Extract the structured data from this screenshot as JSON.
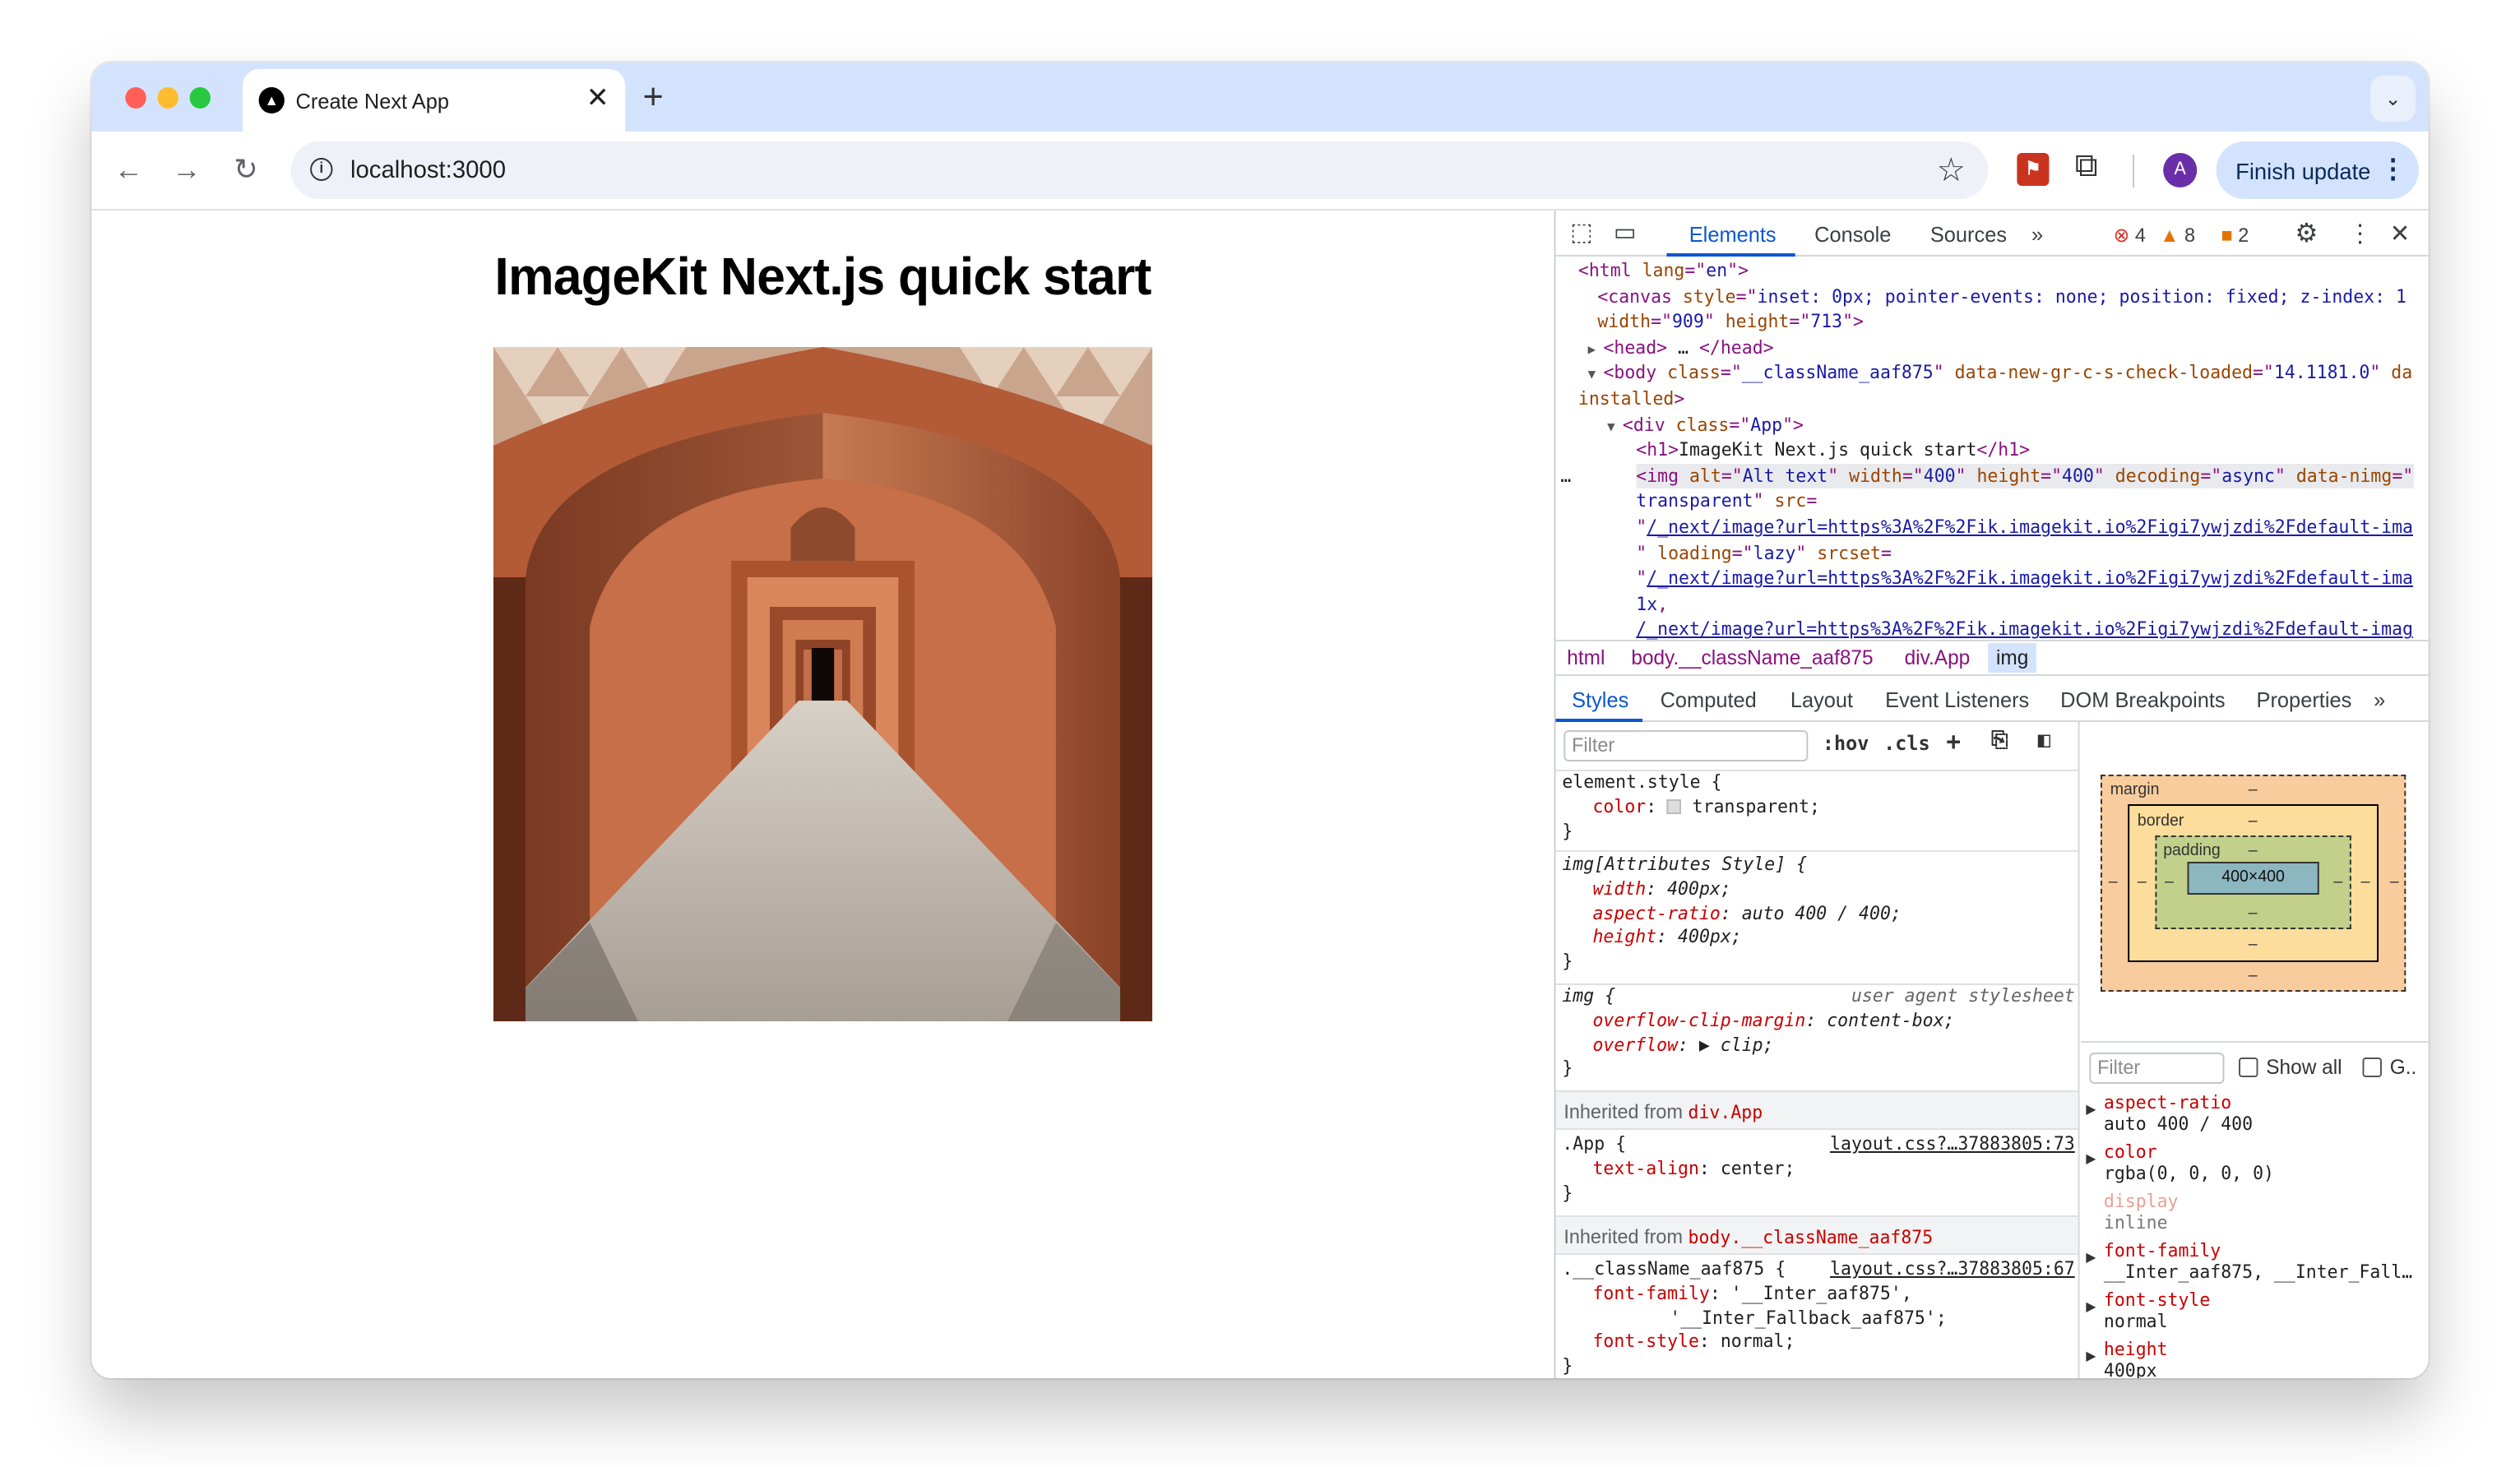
{
  "browser": {
    "tab_title": "Create Next App",
    "tab_favicon": "nextjs-icon",
    "url": "localhost:3000",
    "update_button": "Finish update",
    "avatar_initial": "A"
  },
  "page": {
    "heading": "ImageKit Next.js quick start",
    "image_alt": "Alt text"
  },
  "devtools": {
    "tabs": [
      "Elements",
      "Console",
      "Sources"
    ],
    "active_tab": "Elements",
    "errors": "4",
    "warnings": "8",
    "issues": "2",
    "dom": [
      [
        [
          "tag",
          "<html "
        ],
        [
          "an",
          "lang"
        ],
        [
          "tag",
          "=\""
        ],
        [
          "av",
          "en"
        ],
        [
          "tag",
          "\">"
        ]
      ],
      [
        [
          "tag",
          "<canvas "
        ],
        [
          "an",
          "style"
        ],
        [
          "tag",
          "=\""
        ],
        [
          "av",
          "inset: 0px; pointer-events: none; position: fixed; z-index: 1"
        ]
      ],
      [
        [
          "an",
          "width"
        ],
        [
          "tag",
          "=\""
        ],
        [
          "av",
          "909"
        ],
        [
          "tag",
          "\" "
        ],
        [
          "an",
          "height"
        ],
        [
          "tag",
          "=\""
        ],
        [
          "av",
          "713"
        ],
        [
          "tag",
          "\">"
        ]
      ],
      [
        [
          "tag",
          "<head>"
        ],
        [
          "tx",
          " … "
        ],
        [
          "tag",
          "</head>"
        ]
      ],
      [
        [
          "tag",
          "<body "
        ],
        [
          "an",
          "class"
        ],
        [
          "tag",
          "=\""
        ],
        [
          "av",
          "__className_aaf875"
        ],
        [
          "tag",
          "\" "
        ],
        [
          "an",
          "data-new-gr-c-s-check-loaded"
        ],
        [
          "tag",
          "=\""
        ],
        [
          "av",
          "14.1181.0"
        ],
        [
          "tag",
          "\" "
        ],
        [
          "an",
          "da"
        ]
      ],
      [
        [
          "an",
          "installed"
        ],
        [
          "tag",
          ">"
        ]
      ],
      [
        [
          "tag",
          "<div "
        ],
        [
          "an",
          "class"
        ],
        [
          "tag",
          "=\""
        ],
        [
          "av",
          "App"
        ],
        [
          "tag",
          "\">"
        ]
      ],
      [
        [
          "tag",
          "<h1>"
        ],
        [
          "tx",
          "ImageKit Next.js quick start"
        ],
        [
          "tag",
          "</h1>"
        ]
      ],
      [
        [
          "tag",
          "<img "
        ],
        [
          "an",
          "alt"
        ],
        [
          "tag",
          "=\""
        ],
        [
          "av",
          "Alt text"
        ],
        [
          "tag",
          "\" "
        ],
        [
          "an",
          "width"
        ],
        [
          "tag",
          "=\""
        ],
        [
          "av",
          "400"
        ],
        [
          "tag",
          "\" "
        ],
        [
          "an",
          "height"
        ],
        [
          "tag",
          "=\""
        ],
        [
          "av",
          "400"
        ],
        [
          "tag",
          "\" "
        ],
        [
          "an",
          "decoding"
        ],
        [
          "tag",
          "=\""
        ],
        [
          "av",
          "async"
        ],
        [
          "tag",
          "\" "
        ],
        [
          "an",
          "data-nimg"
        ],
        [
          "tag",
          "=\""
        ]
      ],
      [
        [
          "av",
          "transparent"
        ],
        [
          "tag",
          "\" "
        ],
        [
          "an",
          "src"
        ],
        [
          "tag",
          "="
        ]
      ],
      [
        [
          "tag",
          "\""
        ],
        [
          "lk",
          "/_next/image?url=https%3A%2F%2Fik.imagekit.io%2Figi7ywjzdi%2Fdefault-ima"
        ]
      ],
      [
        [
          "tag",
          "\" "
        ],
        [
          "an",
          "loading"
        ],
        [
          "tag",
          "=\""
        ],
        [
          "av",
          "lazy"
        ],
        [
          "tag",
          "\" "
        ],
        [
          "an",
          "srcset"
        ],
        [
          "tag",
          "="
        ]
      ],
      [
        [
          "tag",
          "\""
        ],
        [
          "lk",
          "/_next/image?url=https%3A%2F%2Fik.imagekit.io%2Figi7ywjzdi%2Fdefault-ima"
        ]
      ],
      [
        [
          "av",
          "1x"
        ],
        [
          "tag",
          ","
        ]
      ],
      [
        [
          "lk",
          "/_next/image?url=https%3A%2F%2Fik.imagekit.io%2Figi7ywjzdi%2Fdefault-imag"
        ]
      ]
    ],
    "breadcrumbs": [
      "html",
      "body.__className_aaf875",
      "div.App",
      "img"
    ],
    "subtabs": [
      "Styles",
      "Computed",
      "Layout",
      "Event Listeners",
      "DOM Breakpoints",
      "Properties"
    ],
    "styles_filter_placeholder": "Filter",
    "tool_hov": ":hov",
    "tool_cls": ".cls",
    "rules": {
      "element_style_selector": "element.style {",
      "element_style_prop": "color",
      "element_style_val": "transparent;",
      "attr_selector": "img[Attributes Style] {",
      "attr_props": [
        [
          "width",
          "400px;"
        ],
        [
          "aspect-ratio",
          "auto 400 / 400;"
        ],
        [
          "height",
          "400px;"
        ]
      ],
      "ua_selector": "img {",
      "ua_label": "user agent stylesheet",
      "ua_props": [
        [
          "overflow-clip-margin",
          "content-box;"
        ],
        [
          "overflow",
          "▶ clip;"
        ]
      ],
      "inherited_app_label": "Inherited from",
      "inherited_app_target": "div.App",
      "app_selector": ".App {",
      "app_source": "layout.css?…37883805:73",
      "app_props": [
        [
          "text-align",
          "center;"
        ]
      ],
      "inherited_body_label": "Inherited from",
      "inherited_body_target": "body.__className_aaf875",
      "body_selector": ".__className_aaf875 {",
      "body_source": "layout.css?…37883805:67",
      "body_props": [
        [
          "font-family",
          "'__Inter_aaf875',"
        ],
        [
          "",
          "'__Inter_Fallback_aaf875';"
        ],
        [
          "font-style",
          "normal;"
        ]
      ],
      "close_brace": "}"
    },
    "box_model": {
      "margin_label": "margin",
      "border_label": "border",
      "padding_label": "padding",
      "content": "400×400",
      "dash": "–"
    },
    "computed": {
      "filter_placeholder": "Filter",
      "show_all": "Show all",
      "group": "G..",
      "props": [
        {
          "name": "aspect-ratio",
          "value": "auto 400 / 400",
          "inherited": false
        },
        {
          "name": "color",
          "value": "rgba(0, 0, 0, 0)",
          "inherited": false
        },
        {
          "name": "display",
          "value": "inline",
          "inherited": true
        },
        {
          "name": "font-family",
          "value": "__Inter_aaf875, __Inter_Fall…",
          "inherited": false
        },
        {
          "name": "font-style",
          "value": "normal",
          "inherited": false
        },
        {
          "name": "height",
          "value": "400px",
          "inherited": false
        }
      ]
    }
  },
  "colors": {
    "tabstrip": "#d3e3fd",
    "accent": "#0b57d0",
    "tag": "#881280",
    "attr_name": "#994500",
    "attr_value": "#1a1aa6",
    "prop": "#c80000",
    "margin_box": "#f9cc9d",
    "border_box": "#fddd9b",
    "padding_box": "#c3d08b",
    "content_box": "#8cb6c0"
  }
}
